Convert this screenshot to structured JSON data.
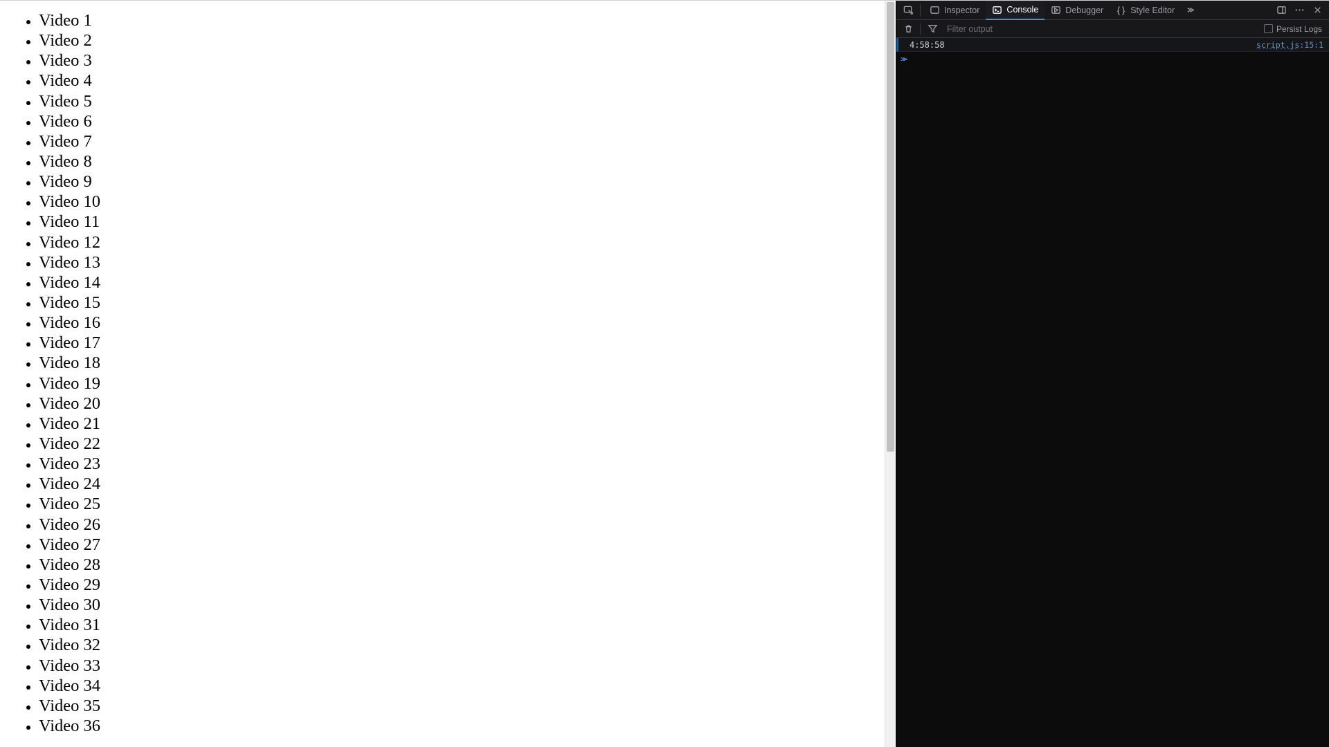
{
  "page": {
    "item_prefix": "Video",
    "item_count": 36
  },
  "devtools": {
    "tabs": {
      "inspector": "Inspector",
      "console": "Console",
      "debugger": "Debugger",
      "style_editor": "Style Editor"
    },
    "active_tab": "console",
    "filter_placeholder": "Filter output",
    "persist_label": "Persist Logs",
    "log": {
      "message": "4:58:58",
      "source_file": "script.js",
      "source_line": "15",
      "source_col": "1"
    }
  }
}
